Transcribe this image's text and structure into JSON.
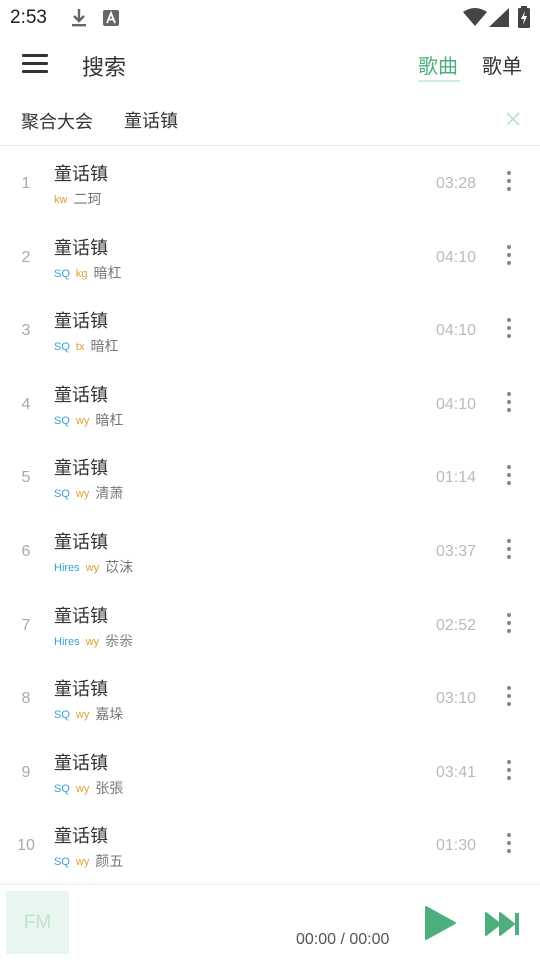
{
  "status_bar": {
    "time": "2:53",
    "icons": [
      "download-icon",
      "font-icon",
      "wifi-icon",
      "signal-icon",
      "battery-charging-icon"
    ]
  },
  "header": {
    "title": "搜索",
    "tabs": [
      {
        "label": "歌曲",
        "active": true
      },
      {
        "label": "歌单",
        "active": false
      }
    ],
    "accent_color": "#4caf7d"
  },
  "search": {
    "source": "聚合大会",
    "query": "童话镇"
  },
  "songs": [
    {
      "index": "1",
      "title": "童话镇",
      "quality": "",
      "source": "kw",
      "artist": "二珂",
      "duration": "03:28"
    },
    {
      "index": "2",
      "title": "童话镇",
      "quality": "SQ",
      "source": "kg",
      "artist": "暗杠",
      "duration": "04:10"
    },
    {
      "index": "3",
      "title": "童话镇",
      "quality": "SQ",
      "source": "tx",
      "artist": "暗杠",
      "duration": "04:10"
    },
    {
      "index": "4",
      "title": "童话镇",
      "quality": "SQ",
      "source": "wy",
      "artist": "暗杠",
      "duration": "04:10"
    },
    {
      "index": "5",
      "title": "童话镇",
      "quality": "SQ",
      "source": "wy",
      "artist": "清萧",
      "duration": "01:14"
    },
    {
      "index": "6",
      "title": "童话镇",
      "quality": "Hires",
      "source": "wy",
      "artist": "苡沫",
      "duration": "03:37"
    },
    {
      "index": "7",
      "title": "童话镇",
      "quality": "Hires",
      "source": "wy",
      "artist": "尜尜",
      "duration": "02:52"
    },
    {
      "index": "8",
      "title": "童话镇",
      "quality": "SQ",
      "source": "wy",
      "artist": "嘉垛",
      "duration": "03:10"
    },
    {
      "index": "9",
      "title": "童话镇",
      "quality": "SQ",
      "source": "wy",
      "artist": "张張",
      "duration": "03:41"
    },
    {
      "index": "10",
      "title": "童话镇",
      "quality": "SQ",
      "source": "wy",
      "artist": "颜五",
      "duration": "01:30"
    }
  ],
  "player": {
    "cover_text": "FM",
    "time": "00:00 / 00:00"
  }
}
